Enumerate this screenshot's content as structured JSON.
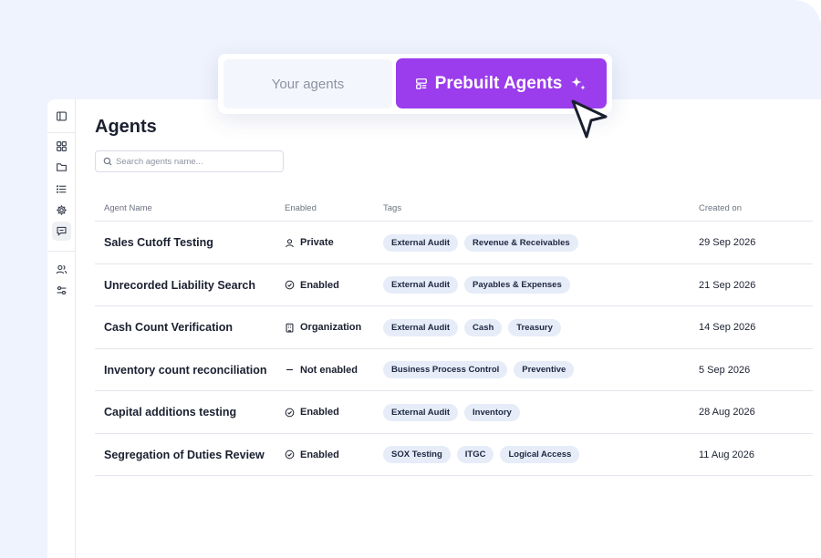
{
  "toggle": {
    "your_agents_label": "Your agents",
    "prebuilt_label": "Prebuilt Agents",
    "accent_color": "#9b3ced"
  },
  "sidebar": {
    "icons": [
      "panel-toggle-icon",
      "grid-icon",
      "folder-icon",
      "list-icon",
      "settings-icon",
      "chat-icon",
      "users-icon",
      "sliders-icon"
    ],
    "active": "chat-icon"
  },
  "page": {
    "title": "Agents",
    "search_placeholder": "Search agents name..."
  },
  "table": {
    "headers": {
      "name": "Agent Name",
      "enabled": "Enabled",
      "tags": "Tags",
      "created": "Created on"
    },
    "rows": [
      {
        "name": "Sales Cutoff Testing",
        "status": "Private",
        "status_icon": "user-icon",
        "tags": [
          "External Audit",
          "Revenue & Receivables"
        ],
        "created": "29 Sep 2026"
      },
      {
        "name": "Unrecorded Liability Search",
        "status": "Enabled",
        "status_icon": "check-circle-icon",
        "tags": [
          "External Audit",
          "Payables & Expenses"
        ],
        "created": "21 Sep 2026"
      },
      {
        "name": "Cash Count Verification",
        "status": "Organization",
        "status_icon": "building-icon",
        "tags": [
          "External Audit",
          "Cash",
          "Treasury"
        ],
        "created": "14 Sep 2026"
      },
      {
        "name": "Inventory count reconciliation",
        "status": "Not enabled",
        "status_icon": "dash-icon",
        "tags": [
          "Business Process Control",
          "Preventive"
        ],
        "created": "5 Sep 2026"
      },
      {
        "name": "Capital additions testing",
        "status": "Enabled",
        "status_icon": "check-circle-icon",
        "tags": [
          "External Audit",
          "Inventory"
        ],
        "created": "28 Aug 2026"
      },
      {
        "name": "Segregation of Duties Review",
        "status": "Enabled",
        "status_icon": "check-circle-icon",
        "tags": [
          "SOX Testing",
          "ITGC",
          "Logical Access"
        ],
        "created": "11 Aug 2026"
      }
    ]
  }
}
